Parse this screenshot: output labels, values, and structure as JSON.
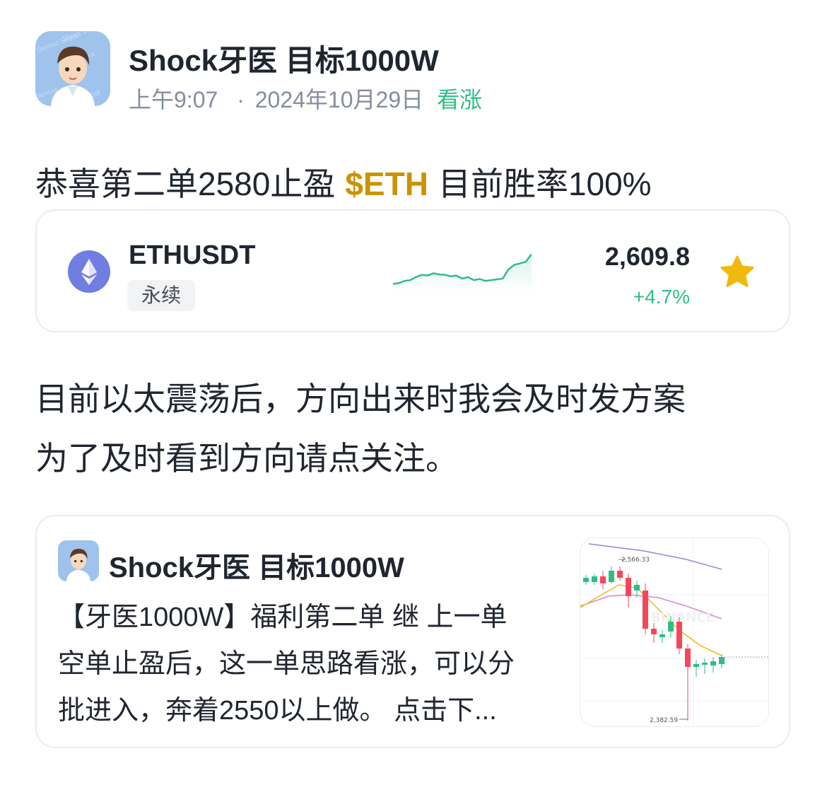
{
  "post": {
    "author": "Shock牙医 目标1000W",
    "time": "上午9:07",
    "separator": "·",
    "date": "2024年10月29日",
    "sentiment": "看涨",
    "line1_before": "恭喜第二单2580止盈",
    "cashtag": "$ETH",
    "line1_after": "目前胜率100%",
    "paragraph": [
      "目前以太震荡后，方向出来时我会及时发方案",
      "为了及时看到方向请点关注。"
    ]
  },
  "ticker": {
    "symbol": "ETHUSDT",
    "badge": "永续",
    "price": "2,609.8",
    "change": "+4.7%",
    "coin_icon": "ethereum-icon",
    "star_icon": "star-icon",
    "up_color": "#2ebd85",
    "star_color": "#f0b90b",
    "sparkline": [
      0.12,
      0.14,
      0.2,
      0.22,
      0.3,
      0.36,
      0.34,
      0.4,
      0.37,
      0.36,
      0.32,
      0.34,
      0.26,
      0.3,
      0.22,
      0.25,
      0.2,
      0.22,
      0.24,
      0.26,
      0.5,
      0.62,
      0.66,
      0.7,
      0.9
    ]
  },
  "quote": {
    "author": "Shock牙医 目标1000W",
    "lines": [
      "【牙医1000W】福利第二单 继 上一单",
      "空单止盈后，这一单思路看涨，可以分",
      "批进入，奔着2550以上做。 点击下..."
    ],
    "chart": {
      "high_label": "2,566.33",
      "low_label": "2,382.59",
      "watermark": "BINANCE"
    }
  }
}
